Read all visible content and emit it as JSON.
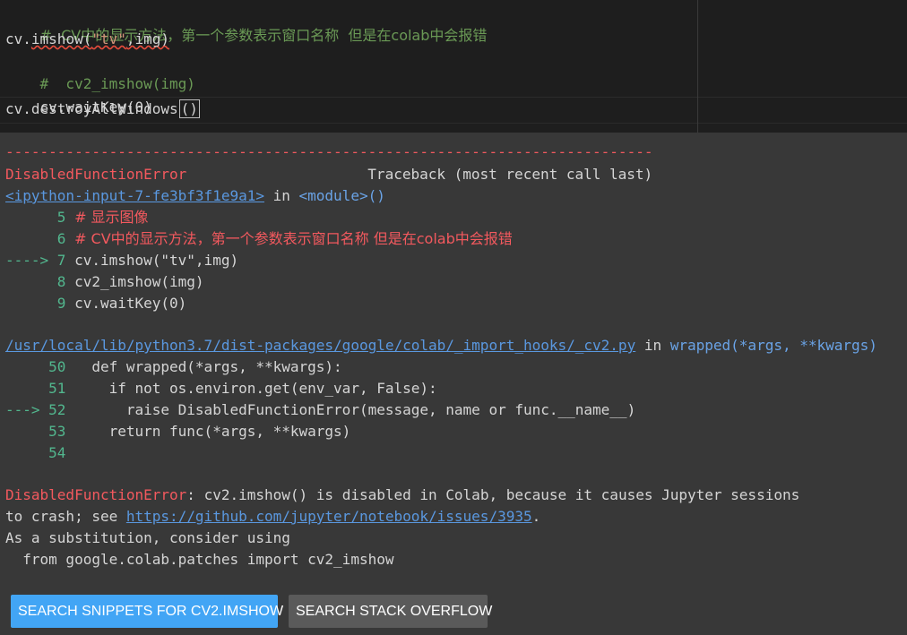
{
  "editor": {
    "line1": "#  CV中的显示方法，第一个参数表示窗口名称  但是在colab中会报错",
    "line2_a": "cv.",
    "line2_b": "imshow(",
    "line2_c": "\"tv\"",
    "line2_d": ",img)",
    "line3": "#  cv2_imshow(img)",
    "line4": "cv.waitKey(0)",
    "line5_a": "cv.destroyAllWindows",
    "line5_b": "()"
  },
  "output": {
    "dashes": "---------------------------------------------------------------------------",
    "error_name": "DisabledFunctionError",
    "traceback_header": "Traceback (most recent call last)",
    "frame1_link": "<ipython-input-7-fe3bf3f1e9a1>",
    "frame1_in": " in ",
    "frame1_module": "<module>()",
    "f1_l5_num": "      5 ",
    "f1_l5_text": "# 显示图像",
    "f1_l6_num": "      6 ",
    "f1_l6_text": "# CV中的显示方法，第一个参数表示窗口名称 但是在colab中会报错",
    "f1_l7_arrow": "----> 7 ",
    "f1_l7_text": "cv.imshow(\"tv\",img)",
    "f1_l8_num": "      8 ",
    "f1_l8_text": "cv2_imshow(img)",
    "f1_l9_num": "      9 ",
    "f1_l9_text": "cv.waitKey(0)",
    "frame2_link": "/usr/local/lib/python3.7/dist-packages/google/colab/_import_hooks/_cv2.py",
    "frame2_in": " in ",
    "frame2_func": "wrapped(*args, **kwargs)",
    "f2_l50_num": "     50 ",
    "f2_l50_text": "  def wrapped(*args, **kwargs):",
    "f2_l51_num": "     51 ",
    "f2_l51_text": "    if not os.environ.get(env_var, False):",
    "f2_l52_arrow": "---> 52 ",
    "f2_l52_text": "      raise DisabledFunctionError(message, name or func.__name__)",
    "f2_l53_num": "     53 ",
    "f2_l53_text": "    return func(*args, **kwargs)",
    "f2_l54_num": "     54 ",
    "msg_error": "DisabledFunctionError",
    "msg_rest": ": cv2.imshow() is disabled in Colab, because it causes Jupyter sessions",
    "msg_line2_a": "to crash; see ",
    "msg_line2_link": "https://github.com/jupyter/notebook/issues/3935",
    "msg_line2_b": ".",
    "msg_line3": "As a substitution, consider using",
    "msg_line4": "  from google.colab.patches import cv2_imshow"
  },
  "buttons": {
    "search_snippets": "SEARCH SNIPPETS FOR CV2.IMSHOW",
    "search_stack_overflow": "SEARCH STACK OVERFLOW"
  }
}
